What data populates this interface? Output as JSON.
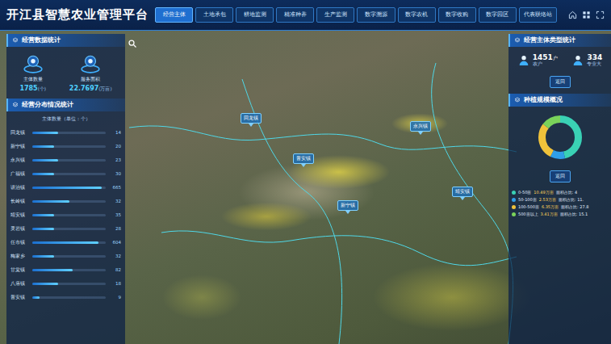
{
  "title": "开江县智慧农业管理平台",
  "tabs": [
    {
      "label": "经营主体",
      "selected": true
    },
    {
      "label": "土地承包",
      "selected": false
    },
    {
      "label": "耕地监测",
      "selected": false
    },
    {
      "label": "精准种养",
      "selected": false
    },
    {
      "label": "生产监测",
      "selected": false
    },
    {
      "label": "数字溯源",
      "selected": false
    },
    {
      "label": "数字农机",
      "selected": false
    },
    {
      "label": "数字收购",
      "selected": false
    },
    {
      "label": "数字园区",
      "selected": false
    },
    {
      "label": "代表联络站",
      "selected": false
    }
  ],
  "left": {
    "stats_title": "经营数据统计",
    "stats": [
      {
        "label": "主体数量",
        "value": "1785",
        "unit": "(个)"
      },
      {
        "label": "服务面积",
        "value": "22.7697",
        "unit": "(万亩)"
      }
    ],
    "dist_title": "经营分布情况统计",
    "dist_subtitle": "主体数量（单位：个）",
    "dist_rows": [
      {
        "name": "回龙镇",
        "value": "14",
        "level": 0.35
      },
      {
        "name": "新宁镇",
        "value": "20",
        "level": 0.3
      },
      {
        "name": "永兴镇",
        "value": "23",
        "level": 0.35
      },
      {
        "name": "广福镇",
        "value": "30",
        "level": 0.3
      },
      {
        "name": "讲治镇",
        "value": "665",
        "level": 0.95
      },
      {
        "name": "长岭镇",
        "value": "32",
        "level": 0.5
      },
      {
        "name": "靖安镇",
        "value": "35",
        "level": 0.3
      },
      {
        "name": "灵岩镇",
        "value": "28",
        "level": 0.3
      },
      {
        "name": "任市镇",
        "value": "604",
        "level": 0.9
      },
      {
        "name": "梅家乡",
        "value": "32",
        "level": 0.3
      },
      {
        "name": "甘棠镇",
        "value": "82",
        "level": 0.55
      },
      {
        "name": "八庙镇",
        "value": "18",
        "level": 0.35
      },
      {
        "name": "普安镇",
        "value": "9",
        "level": 0.1
      }
    ]
  },
  "map": {
    "pins": [
      {
        "label": "回龙镇"
      },
      {
        "label": "永兴镇"
      },
      {
        "label": "普安镇"
      },
      {
        "label": "新宁镇"
      },
      {
        "label": "靖安镇"
      }
    ]
  },
  "right": {
    "type_title": "经营主体类型统计",
    "types": [
      {
        "value": "1451",
        "unit": "户",
        "label": "农户"
      },
      {
        "value": "334",
        "unit": "",
        "label": "专业大"
      }
    ],
    "type_button": "返回",
    "scale_title": "种植规模概况",
    "scale_button": "返回",
    "legend": [
      {
        "range": "0-50亩",
        "area": "10.49万亩",
        "share": "面积占比: 4",
        "value": 46,
        "color": "#3ad1b4"
      },
      {
        "range": "50-100亩",
        "area": "2.53万亩",
        "share": "面积占比: 11.",
        "value": 11.1,
        "color": "#2f9ee8"
      },
      {
        "range": "100-500亩",
        "area": "6.35万亩",
        "share": "面积占比: 27.8",
        "value": 27.8,
        "color": "#f0c23a"
      },
      {
        "range": "500亩以上",
        "area": "3.41万亩",
        "share": "面积占比: 15.1",
        "value": 15.1,
        "color": "#7ad35a"
      }
    ]
  }
}
